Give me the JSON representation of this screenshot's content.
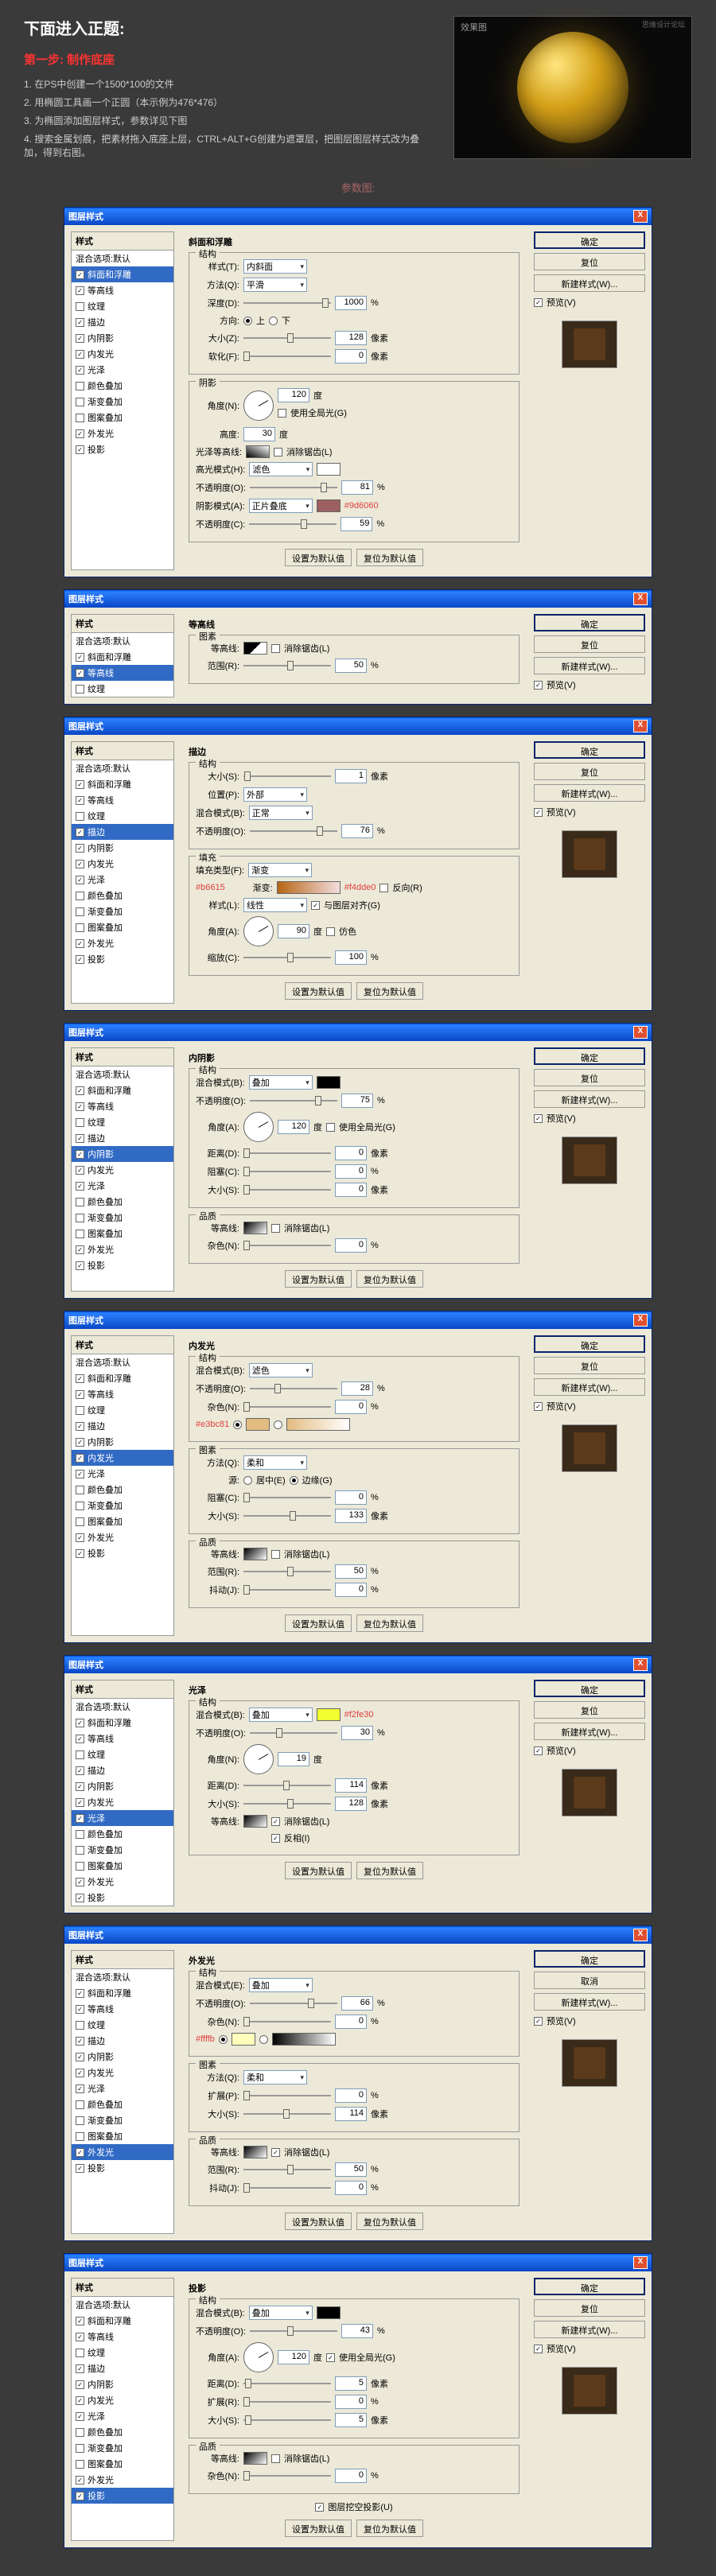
{
  "header": {
    "title": "下面进入正题:",
    "step": "第一步: 制作底座",
    "items": [
      "1. 在PS中创建一个1500*100的文件",
      "2. 用椭圆工具画一个正圆（本示例为476*476）",
      "3. 为椭圆添加图层样式，参数详见下图",
      "4. 搜索金属划痕，把素材拖入底座上层，CTRL+ALT+G创建为遮罩层，把图层图层样式改为叠加，得到右图。"
    ],
    "preview": "效果图",
    "watermark": "思缘设计论坛"
  },
  "section": "参数图:",
  "common": {
    "dialog_title": "图层样式",
    "close": "X",
    "style_header": "样式",
    "blend_default": "混合选项:默认",
    "ok": "确定",
    "cancel": "复位",
    "reset": "取消",
    "new_style": "新建样式(W)...",
    "preview": "预览(V)",
    "reset_default": "设置为默认值",
    "make_default": "复位为默认值"
  },
  "styles": [
    "斜面和浮雕",
    "等高线",
    "纹理",
    "描边",
    "内阴影",
    "内发光",
    "光泽",
    "颜色叠加",
    "渐变叠加",
    "图案叠加",
    "外发光",
    "投影"
  ],
  "d1": {
    "panel": "斜面和浮雕",
    "struct": "结构",
    "style_l": "样式(T):",
    "style_v": "内斜面",
    "tech_l": "方法(Q):",
    "tech_v": "平滑",
    "depth_l": "深度(D):",
    "depth_v": "1000",
    "pct": "%",
    "dir_l": "方向:",
    "up": "上",
    "down": "下",
    "size_l": "大小(Z):",
    "size_v": "128",
    "px": "像素",
    "soft_l": "软化(F):",
    "soft_v": "0",
    "shade": "阴影",
    "angle_l": "角度(N):",
    "angle_v": "120",
    "deg": "度",
    "global": "使用全局光(G)",
    "alt_l": "高度:",
    "alt_v": "30",
    "gloss_l": "光泽等高线:",
    "anti": "消除锯齿(L)",
    "hl_mode_l": "高光模式(H):",
    "hl_mode_v": "滤色",
    "hl_op": "不透明度(O):",
    "hl_op_v": "81",
    "sh_mode_l": "阴影模式(A):",
    "sh_mode_v": "正片叠底",
    "sh_op": "不透明度(C):",
    "sh_op_v": "59",
    "color1": "#9d6060"
  },
  "d2": {
    "panel": "等高线",
    "elem": "图素",
    "contour_l": "等高线:",
    "anti": "消除锯齿(L)",
    "range_l": "范围(R):",
    "range_v": "50"
  },
  "d3": {
    "panel": "描边",
    "struct": "结构",
    "size_l": "大小(S):",
    "size_v": "1",
    "px": "像素",
    "pos_l": "位置(P):",
    "pos_v": "外部",
    "blend_l": "混合模式(B):",
    "blend_v": "正常",
    "op_l": "不透明度(O):",
    "op_v": "76",
    "fill": "填充",
    "type_l": "填充类型(F):",
    "type_v": "渐变",
    "grad_l": "渐变:",
    "rev": "反向(R)",
    "style_l": "样式(L):",
    "style_v": "线性",
    "align": "与图层对齐(G)",
    "angle_l": "角度(A):",
    "angle_v": "90",
    "dither": "仿色",
    "scale_l": "缩放(C):",
    "scale_v": "100",
    "c1": "#b6615",
    "c2": "#f4dde0"
  },
  "d4": {
    "panel": "内阴影",
    "struct": "结构",
    "blend_l": "混合模式(B):",
    "blend_v": "叠加",
    "op_l": "不透明度(O):",
    "op_v": "75",
    "angle_l": "角度(A):",
    "angle_v": "120",
    "global": "使用全局光(G)",
    "dist_l": "距离(D):",
    "dist_v": "0",
    "px": "像素",
    "choke_l": "阻塞(C):",
    "choke_v": "0",
    "size_l": "大小(S):",
    "size_v": "0",
    "qual": "品质",
    "contour_l": "等高线:",
    "anti": "消除锯齿(L)",
    "noise_l": "杂色(N):",
    "noise_v": "0"
  },
  "d5": {
    "panel": "内发光",
    "struct": "结构",
    "blend_l": "混合模式(B):",
    "blend_v": "滤色",
    "op_l": "不透明度(O):",
    "op_v": "28",
    "noise_l": "杂色(N):",
    "noise_v": "0",
    "c1": "#e3bc81",
    "elem": "图素",
    "tech_l": "方法(Q):",
    "tech_v": "柔和",
    "src_l": "源:",
    "center": "居中(E)",
    "edge": "边缘(G)",
    "choke_l": "阻塞(C):",
    "choke_v": "0",
    "size_l": "大小(S):",
    "size_v": "133",
    "px": "像素",
    "qual": "品质",
    "contour_l": "等高线:",
    "anti": "消除锯齿(L)",
    "range_l": "范围(R):",
    "range_v": "50",
    "jitter_l": "抖动(J):",
    "jitter_v": "0"
  },
  "d6": {
    "panel": "光泽",
    "struct": "结构",
    "blend_l": "混合模式(B):",
    "blend_v": "叠加",
    "op_l": "不透明度(O):",
    "op_v": "30",
    "angle_l": "角度(N):",
    "angle_v": "19",
    "dist_l": "距离(D):",
    "dist_v": "114",
    "px": "像素",
    "size_l": "大小(S):",
    "size_v": "128",
    "contour_l": "等高线:",
    "anti": "消除锯齿(L)",
    "inv": "反相(I)",
    "c1": "#f2fe30"
  },
  "d7": {
    "panel": "外发光",
    "struct": "结构",
    "blend_l": "混合模式(E):",
    "blend_v": "叠加",
    "op_l": "不透明度(O):",
    "op_v": "66",
    "noise_l": "杂色(N):",
    "noise_v": "0",
    "c1": "#ffffb",
    "elem": "图素",
    "tech_l": "方法(Q):",
    "tech_v": "柔和",
    "spread_l": "扩展(P):",
    "spread_v": "0",
    "size_l": "大小(S):",
    "size_v": "114",
    "px": "像素",
    "qual": "品质",
    "contour_l": "等高线:",
    "anti": "消除锯齿(L)",
    "range_l": "范围(R):",
    "range_v": "50",
    "jitter_l": "抖动(J):",
    "jitter_v": "0"
  },
  "d8": {
    "panel": "投影",
    "struct": "结构",
    "blend_l": "混合模式(B):",
    "blend_v": "叠加",
    "op_l": "不透明度(O):",
    "op_v": "43",
    "angle_l": "角度(A):",
    "angle_v": "120",
    "global": "使用全局光(G)",
    "dist_l": "距离(D):",
    "dist_v": "5",
    "px": "像素",
    "spread_l": "扩展(R):",
    "spread_v": "0",
    "size_l": "大小(S):",
    "size_v": "5",
    "qual": "品质",
    "contour_l": "等高线:",
    "anti": "消除锯齿(L)",
    "noise_l": "杂色(N):",
    "noise_v": "0",
    "knockout": "图层挖空投影(U)"
  }
}
